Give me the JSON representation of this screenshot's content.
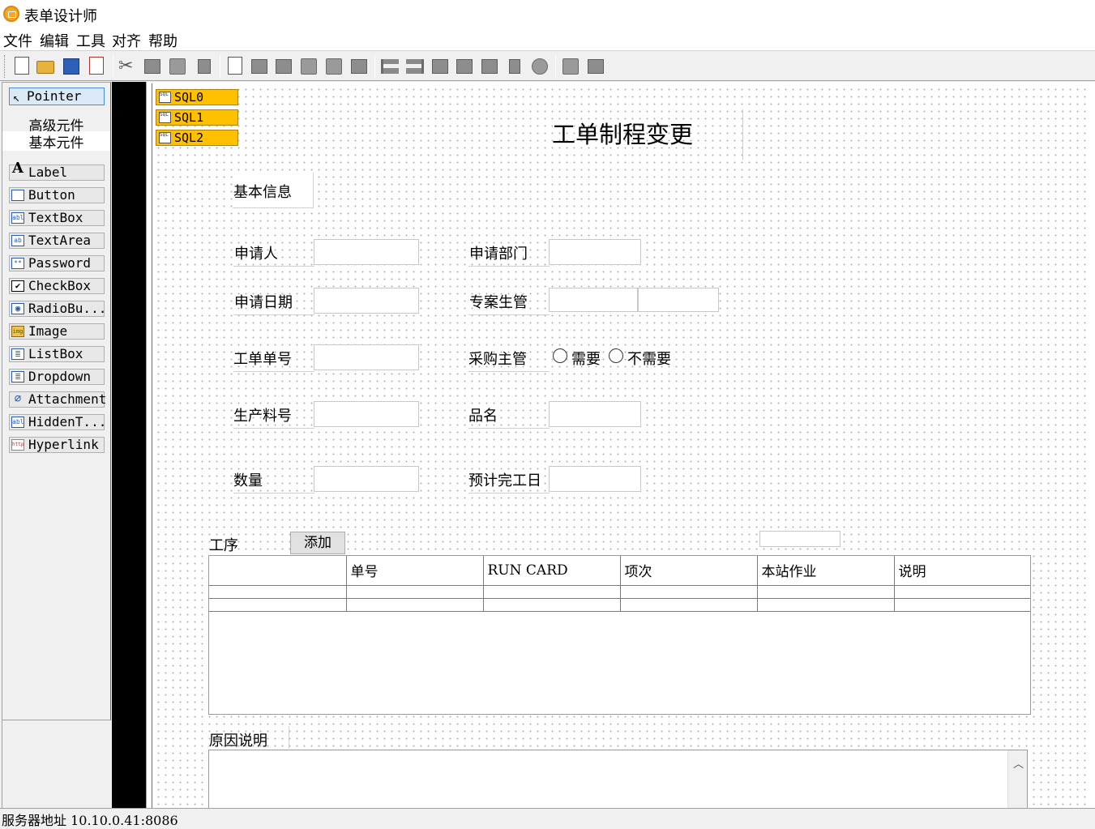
{
  "window": {
    "title": "表单设计师"
  },
  "menu": [
    "文件",
    "编辑",
    "工具",
    "对齐",
    "帮助"
  ],
  "toolbar": {
    "buttons": [
      "new-doc-icon",
      "open-folder-icon",
      "save-disk-icon",
      "save-as-icon",
      "cut-icon",
      "copy-icon",
      "paste-icon",
      "delete-icon",
      "preview-icon",
      "property-icon",
      "edit-icon",
      "grid-icon",
      "layer-icon",
      "page-icon",
      "align-left-icon",
      "align-right-icon",
      "align-top-icon",
      "align-bottom-icon",
      "same-width-icon",
      "same-height-icon",
      "center-icon",
      "group-icon",
      "ungroup-icon"
    ]
  },
  "palette": {
    "pointer": "Pointer",
    "categories": {
      "advanced": "高级元件",
      "basic": "基本元件"
    },
    "tools": [
      {
        "label": "Label",
        "icon": "A"
      },
      {
        "label": "Button",
        "icon": "▭"
      },
      {
        "label": "TextBox",
        "icon": "abl"
      },
      {
        "label": "TextArea",
        "icon": "ab"
      },
      {
        "label": "Password",
        "icon": "**"
      },
      {
        "label": "CheckBox",
        "icon": "✔"
      },
      {
        "label": "RadioBu...",
        "icon": "◉"
      },
      {
        "label": "Image",
        "icon": "img"
      },
      {
        "label": "ListBox",
        "icon": "≣"
      },
      {
        "label": "Dropdown",
        "icon": "≣"
      },
      {
        "label": "Attachment",
        "icon": "⌀"
      },
      {
        "label": "HiddenT...",
        "icon": "abl"
      },
      {
        "label": "Hyperlink",
        "icon": "http"
      }
    ]
  },
  "form": {
    "sql": [
      "SQL0",
      "SQL1",
      "SQL2"
    ],
    "title": "工单制程变更",
    "section": "基本信息",
    "labels": {
      "applicant": "申请人",
      "department": "申请部门",
      "date": "申请日期",
      "project_manager": "专案生管",
      "order_no": "工单单号",
      "purchase_manager": "采购主管",
      "material_no": "生产料号",
      "product_name": "品名",
      "quantity": "数量",
      "finish_date": "预计完工日"
    },
    "radio": {
      "need": "需要",
      "no_need": "不需要"
    },
    "process": {
      "label": "工序",
      "add_button": "添加"
    },
    "grid": {
      "columns": [
        "",
        "单号",
        "RUN CARD",
        "项次",
        "本站作业",
        "说明"
      ],
      "rows": 2
    },
    "reason": "原因说明"
  },
  "status": {
    "server": "服务器地址 10.10.0.41:8086"
  }
}
